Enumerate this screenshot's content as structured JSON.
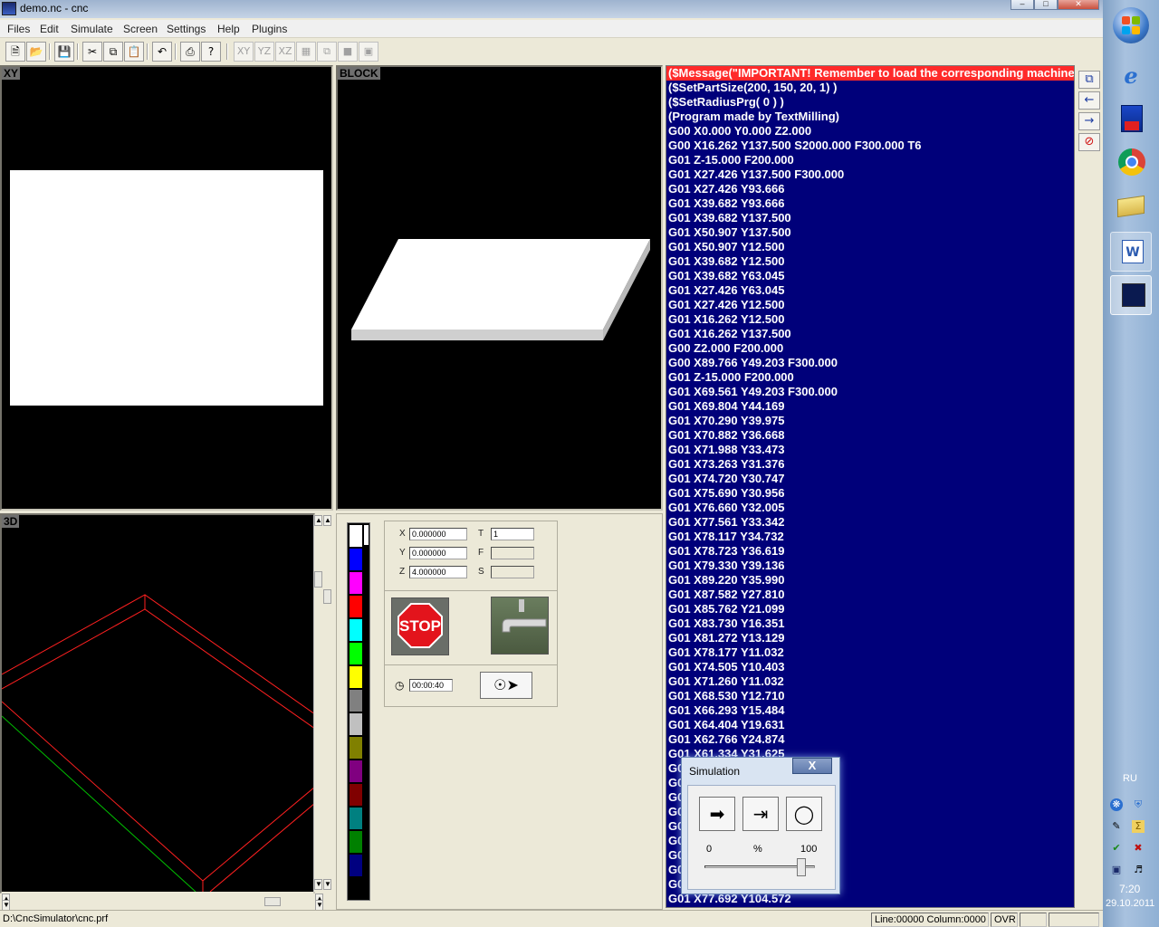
{
  "window": {
    "title": "demo.nc - cnc"
  },
  "menu": [
    "Files",
    "Edit",
    "Simulate",
    "Screen",
    "Settings",
    "Help",
    "Plugins"
  ],
  "toolbar": {
    "view_buttons": [
      "XY",
      "YZ",
      "XZ"
    ]
  },
  "panels": {
    "xy": "XY",
    "block": "BLOCK",
    "three_d": "3D"
  },
  "palette_colors": [
    "#ffffff",
    "#0000ff",
    "#ff00ff",
    "#ff0000",
    "#00ffff",
    "#00ff00",
    "#ffff00",
    "#808080",
    "#c0c0c0",
    "#808000",
    "#800080",
    "#800000",
    "#008080",
    "#008000",
    "#000080"
  ],
  "controls": {
    "x_label": "X",
    "x_value": "0.000000",
    "y_label": "Y",
    "y_value": "0.000000",
    "z_label": "Z",
    "z_value": "4.000000",
    "t_label": "T",
    "t_value": "1",
    "f_label": "F",
    "f_value": "",
    "s_label": "S",
    "s_value": "",
    "stop_label": "STOP",
    "timer_value": "00:00:40"
  },
  "code_lines": [
    "($Message(\"IMPORTANT! Remember to load the corresponding machine",
    "($SetPartSize(200, 150, 20, 1) )",
    "($SetRadiusPrg( 0 ) )",
    "(Program made by TextMilling)",
    "G00 X0.000 Y0.000 Z2.000",
    "G00 X16.262 Y137.500 S2000.000 F300.000 T6",
    "G01 Z-15.000 F200.000",
    "G01 X27.426 Y137.500 F300.000",
    "G01 X27.426 Y93.666",
    "G01 X39.682 Y93.666",
    "G01 X39.682 Y137.500",
    "G01 X50.907 Y137.500",
    "G01 X50.907 Y12.500",
    "G01 X39.682 Y12.500",
    "G01 X39.682 Y63.045",
    "G01 X27.426 Y63.045",
    "G01 X27.426 Y12.500",
    "G01 X16.262 Y12.500",
    "G01 X16.262 Y137.500",
    "G00 Z2.000 F200.000",
    "G00 X89.766 Y49.203 F300.000",
    "G01 Z-15.000 F200.000",
    "G01 X69.561 Y49.203 F300.000",
    "G01 X69.804 Y44.169",
    "G01 X70.290 Y39.975",
    "G01 X70.882 Y36.668",
    "G01 X71.988 Y33.473",
    "G01 X73.263 Y31.376",
    "G01 X74.720 Y30.747",
    "G01 X75.690 Y30.956",
    "G01 X76.660 Y32.005",
    "G01 X77.561 Y33.342",
    "G01 X78.117 Y34.732",
    "G01 X78.723 Y36.619",
    "G01 X79.330 Y39.136",
    "G01 X89.220 Y35.990",
    "G01 X87.582 Y27.810",
    "G01 X85.762 Y21.099",
    "G01 X83.730 Y16.351",
    "G01 X81.272 Y13.129",
    "G01 X78.177 Y11.032",
    "G01 X74.505 Y10.403",
    "G01 X71.260 Y11.032",
    "G01 X68.530 Y12.710",
    "G01 X66.293 Y15.484",
    "G01 X64.404 Y19.631",
    "G01 X62.766 Y24.874",
    "G01 X61.334 Y31.625",
    "G0",
    "G0",
    "G0",
    "G0",
    "G0",
    "G0",
    "G0",
    "G0",
    "G0",
    "G01 X77.692 Y104.572"
  ],
  "simulation": {
    "title": "Simulation",
    "close": "X",
    "min_label": "0",
    "unit_label": "%",
    "max_label": "100",
    "speed_fraction": 0.88
  },
  "status": {
    "path": "D:\\CncSimulator\\cnc.prf",
    "position": "Line:00000 Column:0000",
    "mode": "OVR"
  },
  "taskbar": {
    "language": "RU",
    "time": "7:20",
    "date": "29.10.2011"
  }
}
